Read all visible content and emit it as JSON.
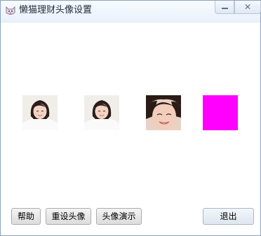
{
  "window": {
    "title": "懒猫理财头像设置",
    "app_icon": "cat-face-icon",
    "minimize_icon": "minimize-icon",
    "close_icon": "close-icon",
    "close_glyph": "✕"
  },
  "avatars": [
    {
      "name": "avatar-option-1",
      "icon": "girl-photo-small",
      "color": null
    },
    {
      "name": "avatar-option-2",
      "icon": "girl-photo-small",
      "color": null
    },
    {
      "name": "avatar-option-3",
      "icon": "girl-photo-closeup",
      "color": null
    },
    {
      "name": "avatar-option-4",
      "icon": "solid-color-swatch",
      "color": "#ff00ff"
    }
  ],
  "buttons": {
    "help": "帮助",
    "reset_avatar": "重设头像",
    "avatar_demo": "头像演示",
    "exit": "退出"
  }
}
